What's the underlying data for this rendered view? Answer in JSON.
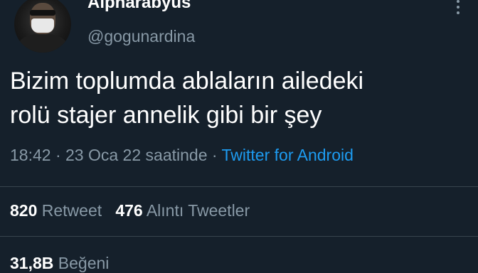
{
  "author": {
    "display_name": "Alpharabyus",
    "handle": "@gogunardina"
  },
  "tweet": {
    "line1": "Bizim toplumda ablaların ailedeki",
    "line2": "rolü stajer annelik gibi bir şey"
  },
  "meta": {
    "time": "18:42",
    "sep1": " · ",
    "date": "23 Oca 22 saatinde",
    "sep2": " · ",
    "source": "Twitter for Android"
  },
  "stats": {
    "retweets_count": "820",
    "retweets_label": "Retweet",
    "quotes_count": "476",
    "quotes_label": "Alıntı Tweetler",
    "likes_count": "31,8B",
    "likes_label": "Beğeni"
  },
  "colors": {
    "background": "#15202b",
    "secondary_text": "#8899a6",
    "link": "#1d9bf0"
  },
  "icons": {
    "more": "more-vertical-icon"
  }
}
